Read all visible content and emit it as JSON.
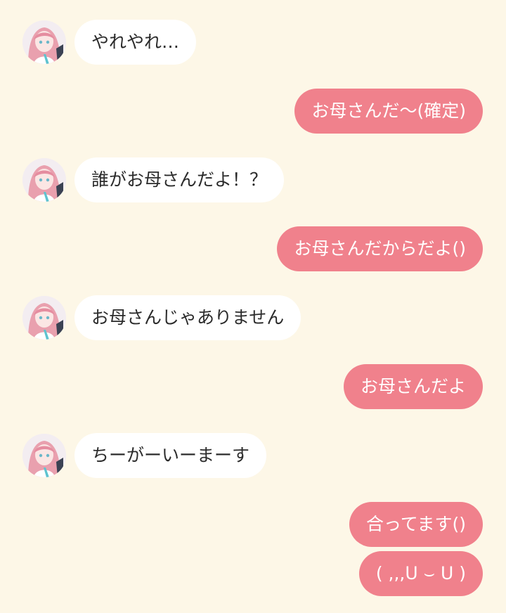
{
  "colors": {
    "background": "#fdf7e7",
    "incoming_bubble": "#ffffff",
    "outgoing_bubble": "#f0818c",
    "incoming_text": "#2b2b2b",
    "outgoing_text": "#ffffff"
  },
  "messages": [
    {
      "sender": "other",
      "text": "やれやれ…"
    },
    {
      "sender": "me",
      "text": "お母さんだ〜(確定)"
    },
    {
      "sender": "other",
      "text": "誰がお母さんだよ！？"
    },
    {
      "sender": "me",
      "text": "お母さんだからだよ()"
    },
    {
      "sender": "other",
      "text": "お母さんじゃありません"
    },
    {
      "sender": "me",
      "text": "お母さんだよ"
    },
    {
      "sender": "other",
      "text": "ちーがーいーまーす"
    },
    {
      "sender": "me",
      "text": "合ってます()"
    },
    {
      "sender": "me",
      "text": "( ,,,ᑌ ⌣ ᑌ )"
    }
  ]
}
